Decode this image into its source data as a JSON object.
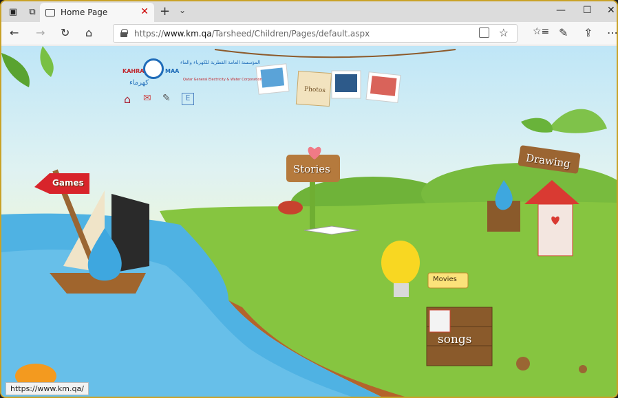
{
  "browser": {
    "tab_title": "Home Page",
    "address_protocol": "https://",
    "address_host": "www.km.qa",
    "address_path": "/Tarsheed/Children/Pages/default.aspx",
    "status_url": "https://www.km.qa/"
  },
  "logo": {
    "brand_left": "KAHRA",
    "brand_right": "MAA",
    "arabic_name": "المؤسسة العامة القطرية للكهرباء والماء",
    "english_name": "Qatar General Electricity & Water Corporation",
    "arabic_mark": "كهرماء"
  },
  "scene": {
    "photos_label": "Photos",
    "stories_label": "Stories",
    "games_label": "Games",
    "drawing_label": "Drawing",
    "movies_label": "Movies",
    "songs_label": "songs"
  },
  "colors": {
    "tab_close": "#cc0000",
    "games_sign": "#d8242b",
    "grass": "#7cc242",
    "water": "#4fb2e3",
    "wood": "#a0652d"
  },
  "icons": [
    "home-icon",
    "mail-icon",
    "edit-icon",
    "e-icon",
    "back-icon",
    "forward-icon",
    "refresh-icon",
    "home-nav-icon",
    "favorites-icon",
    "collections-icon",
    "pen-icon",
    "share-icon",
    "more-icon"
  ]
}
